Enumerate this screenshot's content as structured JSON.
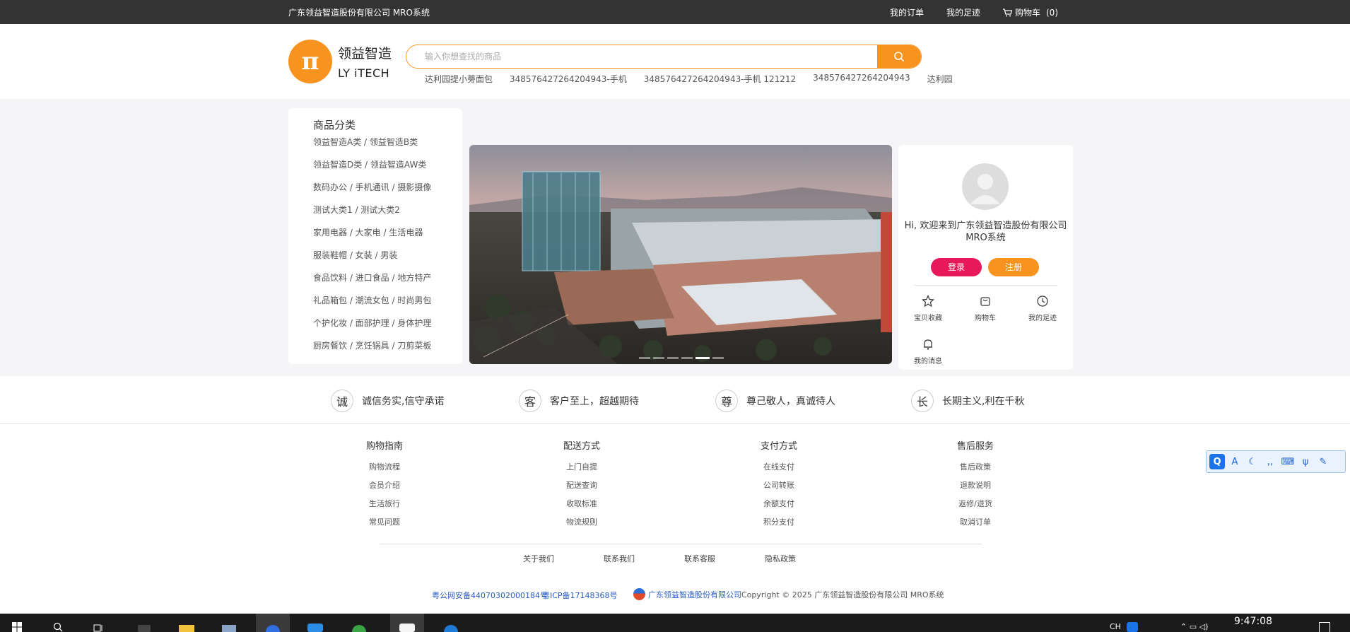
{
  "topbar": {
    "company": "广东领益智造股份有限公司 MRO系统",
    "my_orders": "我的订单",
    "my_footprint": "我的足迹",
    "cart": "购物车",
    "cart_count": "(0)"
  },
  "header": {
    "logo_cn": "领益智造",
    "logo_en": "LY iTECH",
    "search_placeholder": "输入你想查找的商品",
    "hot_words": [
      "达利园提小蒡面包",
      "348576427264204943-手机",
      "348576427264204943-手机 121212",
      "348576427264204943",
      "达利园"
    ]
  },
  "categories": {
    "title": "商品分类",
    "items": [
      "领益智造A类 / 领益智造B类",
      "领益智造D类 / 领益智造AW类",
      "数码办公 / 手机通讯 / 摄影摄像",
      "测试大类1 / 测试大类2",
      "家用电器 / 大家电 / 生活电器",
      "服装鞋帽 / 女装 / 男装",
      "食品饮料 / 进口食品 / 地方特产",
      "礼品箱包 / 潮流女包 / 时尚男包",
      "个护化妆 / 面部护理 / 身体护理",
      "厨房餐饮 / 烹饪锅具 / 刀剪菜板"
    ]
  },
  "banner": {
    "slides": 6,
    "active_slide": 5
  },
  "user": {
    "welcome": "Hi, 欢迎来到广东领益智造股份有限公司MRO系统",
    "login": "登录",
    "register": "注册",
    "quick": [
      "宝贝收藏",
      "购物车",
      "我的足迹",
      "我的消息"
    ]
  },
  "values": [
    {
      "char": "诚",
      "text": "诚信务实,信守承诺"
    },
    {
      "char": "客",
      "text": "客户至上，超越期待"
    },
    {
      "char": "尊",
      "text": "尊己敬人，真诚待人"
    },
    {
      "char": "长",
      "text": "长期主义,利在千秋"
    }
  ],
  "footer": {
    "columns": [
      {
        "title": "购物指南",
        "items": [
          "购物流程",
          "会员介绍",
          "生活旅行",
          "常见问题"
        ]
      },
      {
        "title": "配送方式",
        "items": [
          "上门自提",
          "配送查询",
          "收取标准",
          "物流规则"
        ]
      },
      {
        "title": "支付方式",
        "items": [
          "在线支付",
          "公司转账",
          "余额支付",
          "积分支付"
        ]
      },
      {
        "title": "售后服务",
        "items": [
          "售后政策",
          "退款说明",
          "返修/退货",
          "取消订单"
        ]
      }
    ],
    "links": [
      "关于我们",
      "联系我们",
      "联系客服",
      "隐私政策"
    ],
    "icp_security": "粤公网安备44070302000184号",
    "icp": "粤ICP备17148368号",
    "company_link": "广东领益智造股份有限公司",
    "copyright": "Copyright © 2025 广东领益智造股份有限公司 MRO系统"
  },
  "taskbar": {
    "ime_lang": "CH",
    "time": "9:47:08"
  },
  "colors": {
    "accent": "#f7931e",
    "login": "#e8195a",
    "topbar": "#333333"
  }
}
